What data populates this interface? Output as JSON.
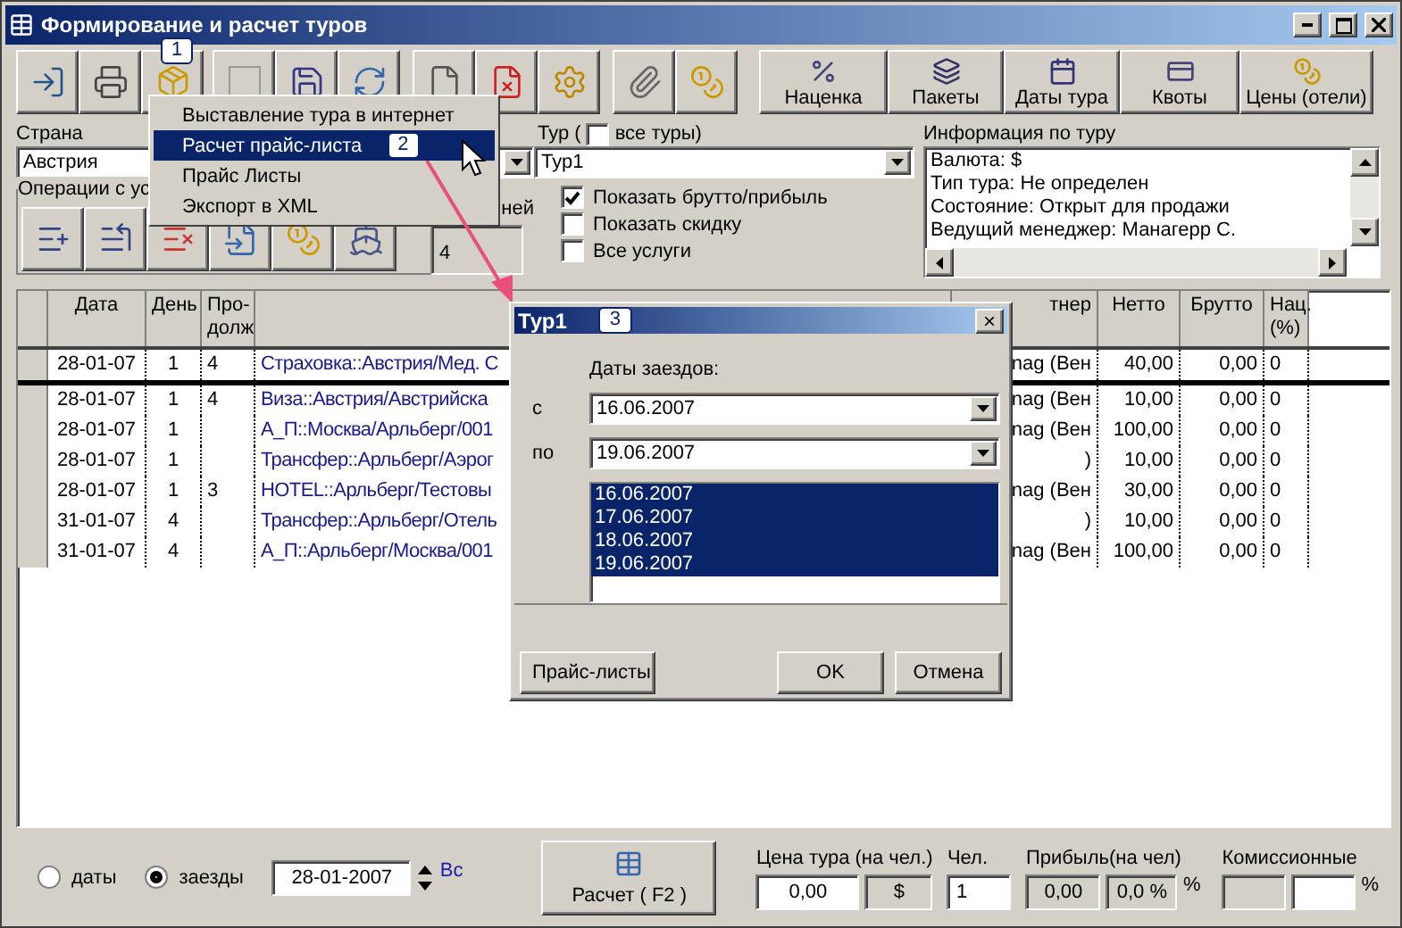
{
  "window": {
    "title": "Формирование и расчет туров"
  },
  "toolbar": {
    "badge": "1",
    "buttons": [
      {
        "label": "Наценка"
      },
      {
        "label": "Пакеты"
      },
      {
        "label": "Даты тура"
      },
      {
        "label": "Квоты"
      },
      {
        "label": "Цены (отели)"
      }
    ]
  },
  "filters": {
    "country_label": "Страна",
    "country": "Австрия",
    "operations_label": "Операции с ус",
    "days_label": "ней",
    "days": "4",
    "tour_label": "Тур (",
    "all_tours": {
      "label": "все туры)",
      "checked": false
    },
    "tour": "Тур1",
    "options": [
      {
        "label": "Показать брутто/прибыль",
        "checked": true
      },
      {
        "label": "Показать скидку",
        "checked": false
      },
      {
        "label": "Все услуги",
        "checked": false
      }
    ]
  },
  "tour_info": {
    "title": "Информация по туру",
    "lines": [
      "Валюта: $",
      "Тип тура: Не определен",
      "Состояние: Открыт для продажи",
      "Ведущий менеджер: Манагерр С."
    ]
  },
  "table": {
    "columns": [
      "Дата",
      "День",
      "Про-\nдолж",
      "",
      "тнер",
      "Нетто",
      "Брутто",
      "Нац.\n(%)"
    ],
    "rows": [
      {
        "selected": true,
        "cells": [
          "28-01-07",
          "1",
          "4",
          "Страховка::Австрия/Мед. С",
          "nag (Вен",
          "40,00",
          "0,00",
          "0"
        ]
      },
      {
        "selected": false,
        "cells": [
          "28-01-07",
          "1",
          "4",
          "Виза::Австрия/Австрийска",
          "nag (Вен",
          "10,00",
          "0,00",
          "0"
        ]
      },
      {
        "selected": false,
        "cells": [
          "28-01-07",
          "1",
          "",
          "А_П::Москва/Арльберг/001",
          "nag (Вен",
          "100,00",
          "0,00",
          "0"
        ]
      },
      {
        "selected": false,
        "cells": [
          "28-01-07",
          "1",
          "",
          "Трансфер::Арльберг/Аэрог",
          ")",
          "10,00",
          "0,00",
          "0"
        ]
      },
      {
        "selected": false,
        "cells": [
          "28-01-07",
          "1",
          "3",
          "HOTEL::Арльберг/Тестовы",
          "nag (Вен",
          "30,00",
          "0,00",
          "0"
        ]
      },
      {
        "selected": false,
        "cells": [
          "31-01-07",
          "4",
          "",
          "Трансфер::Арльберг/Отель",
          ")",
          "10,00",
          "0,00",
          "0"
        ]
      },
      {
        "selected": false,
        "cells": [
          "31-01-07",
          "4",
          "",
          "А_П::Арльберг/Москва/001",
          "nag (Вен",
          "100,00",
          "0,00",
          "0"
        ]
      }
    ]
  },
  "bottom": {
    "modes": [
      {
        "label": "даты",
        "selected": false
      },
      {
        "label": "заезды",
        "selected": true
      }
    ],
    "date": "28-01-2007",
    "weekday": "Вс",
    "calc_button": "Расчет ( F2 )",
    "price_label": "Цена тура (на чел.)",
    "price": "0,00",
    "currency": "$",
    "persons_label": "Чел.",
    "persons": "1",
    "profit_label": "Прибыль(на чел)",
    "profit": "0,00",
    "profit_pct": "0,0 %",
    "profit_sign": "%",
    "commission_label": "Комиссионные",
    "commission_sign": "%"
  },
  "menu": {
    "items": [
      {
        "label": "Выставление тура в интернет",
        "selected": false
      },
      {
        "label": "Расчет прайс-листа",
        "selected": true,
        "badge": "2"
      },
      {
        "label": "Прайс Листы",
        "selected": false
      },
      {
        "label": "Экспорт в XML",
        "selected": false
      }
    ]
  },
  "dialog": {
    "title": "Тур1",
    "badge": "3",
    "close": "×",
    "dates_label": "Даты заездов:",
    "from_label": "с",
    "from": "16.06.2007",
    "to_label": "по",
    "to": "19.06.2007",
    "dates": [
      {
        "text": "16.06.2007",
        "selected": true
      },
      {
        "text": "17.06.2007",
        "selected": true
      },
      {
        "text": "18.06.2007",
        "selected": true
      },
      {
        "text": "19.06.2007",
        "selected": true
      }
    ],
    "buttons": [
      "Прайс-листы",
      "OK",
      "Отмена"
    ]
  }
}
